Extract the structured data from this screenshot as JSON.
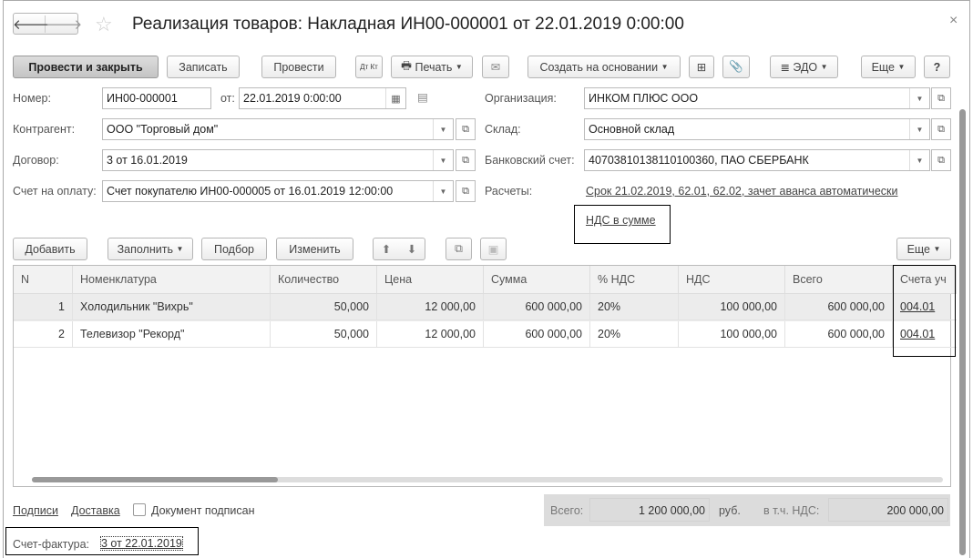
{
  "window": {
    "title": "Реализация товаров: Накладная ИН00-000001 от 22.01.2019 0:00:00",
    "close": "×"
  },
  "toolbar": {
    "post_close": "Провести и закрыть",
    "save": "Записать",
    "post": "Провести",
    "dtkt": "Дт Кт",
    "print": "Печать",
    "create_based": "Создать на основании",
    "edo": "ЭДО",
    "more": "Еще",
    "help": "?"
  },
  "form": {
    "number_label": "Номер:",
    "number": "ИН00-000001",
    "date_label": "от:",
    "date": "22.01.2019  0:00:00",
    "counterparty_label": "Контрагент:",
    "counterparty": "ООО \"Торговый дом\"",
    "contract_label": "Договор:",
    "contract": "3 от 16.01.2019",
    "invoice_label": "Счет на оплату:",
    "invoice": "Счет покупателю ИН00-000005 от 16.01.2019 12:00:00",
    "org_label": "Организация:",
    "org": "ИНКОМ ПЛЮС ООО",
    "warehouse_label": "Склад:",
    "warehouse": "Основной склад",
    "bank_label": "Банковский счет:",
    "bank": "40703810138110100360, ПАО СБЕРБАНК",
    "settlements_label": "Расчеты:",
    "settlements": "Срок 21.02.2019, 62.01, 62.02, зачет аванса автоматически",
    "vat_link": "НДС в сумме"
  },
  "table_toolbar": {
    "add": "Добавить",
    "fill": "Заполнить",
    "pick": "Подбор",
    "change": "Изменить",
    "more": "Еще"
  },
  "table": {
    "headers": [
      "N",
      "Номенклатура",
      "Количество",
      "Цена",
      "Сумма",
      "% НДС",
      "НДС",
      "Всего",
      "Счета уч"
    ],
    "rows": [
      [
        "1",
        "Холодильник \"Вихрь\"",
        "50,000",
        "12 000,00",
        "600 000,00",
        "20%",
        "100 000,00",
        "600 000,00",
        "004.01"
      ],
      [
        "2",
        "Телевизор \"Рекорд\"",
        "50,000",
        "12 000,00",
        "600 000,00",
        "20%",
        "100 000,00",
        "600 000,00",
        "004.01"
      ]
    ]
  },
  "footer": {
    "signatures": "Подписи",
    "delivery": "Доставка",
    "signed": "Документ подписан",
    "signed_checked": false,
    "total_label": "Всего:",
    "total": "1 200 000,00",
    "currency": "руб.",
    "vat_label": "в т.ч. НДС:",
    "vat": "200 000,00",
    "invoice_label": "Счет-фактура:",
    "invoice": "3 от 22.01.2019"
  }
}
